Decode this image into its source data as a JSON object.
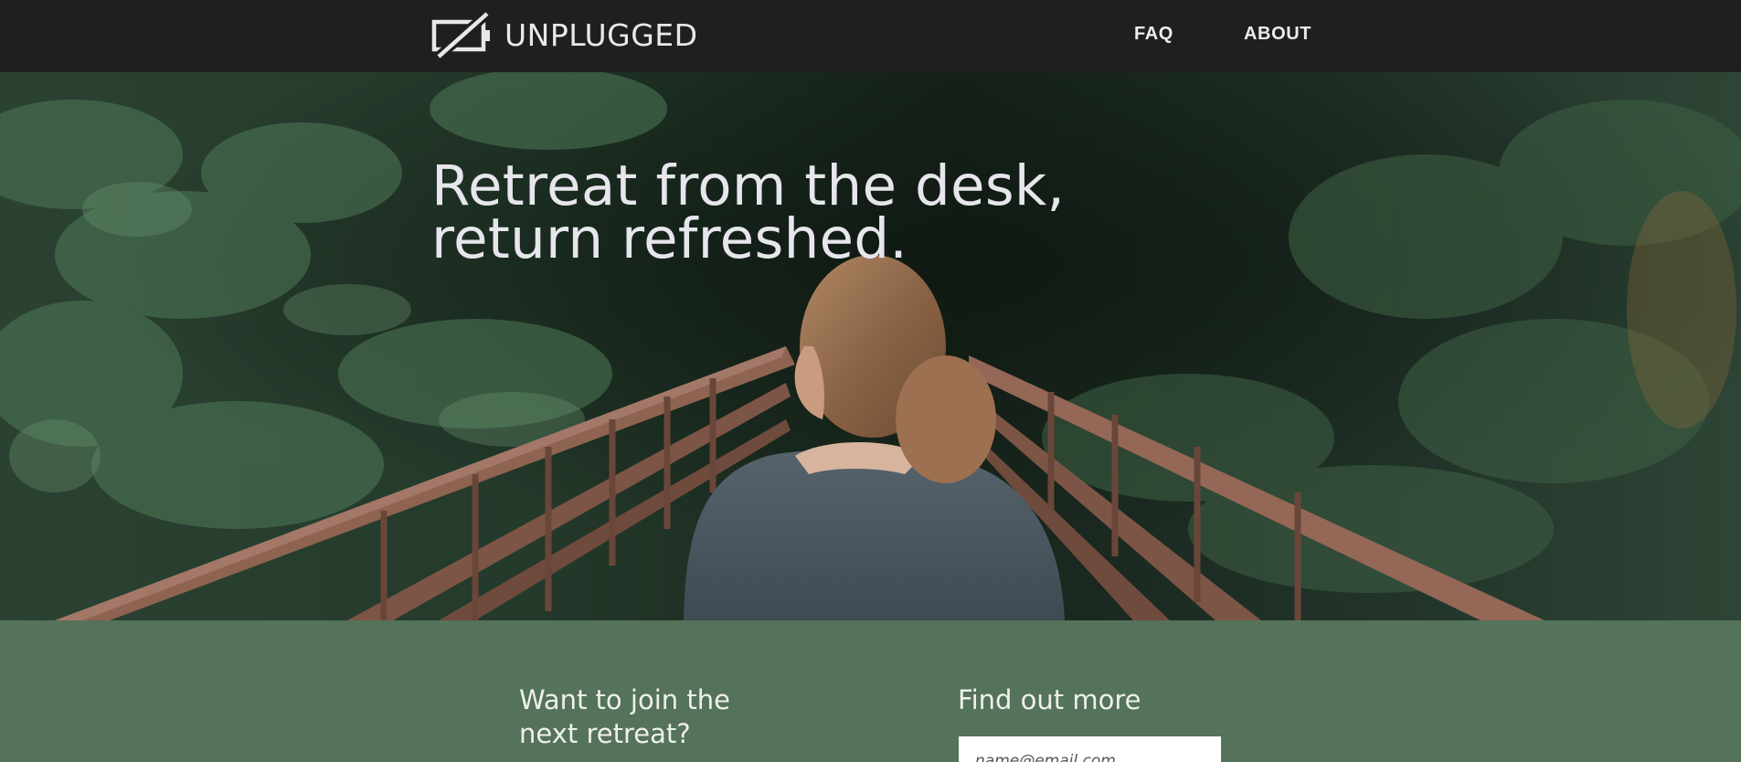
{
  "header": {
    "brand": "UNPLUGGED",
    "logo_icon": "battery-slash-icon",
    "nav": [
      {
        "label": "FAQ"
      },
      {
        "label": "ABOUT"
      }
    ]
  },
  "hero": {
    "title_line1": "Retreat from the desk,",
    "title_line2": "return refreshed.",
    "image": "woman-on-forest-bridge"
  },
  "signup": {
    "join_line1": "Want to join the",
    "join_line2": "next retreat?",
    "more_heading": "Find out more",
    "email_placeholder": "name@email.com"
  },
  "colors": {
    "header_bg": "#1f1f1f",
    "signup_bg": "#55725a",
    "text_light": "#e6e6ec"
  }
}
